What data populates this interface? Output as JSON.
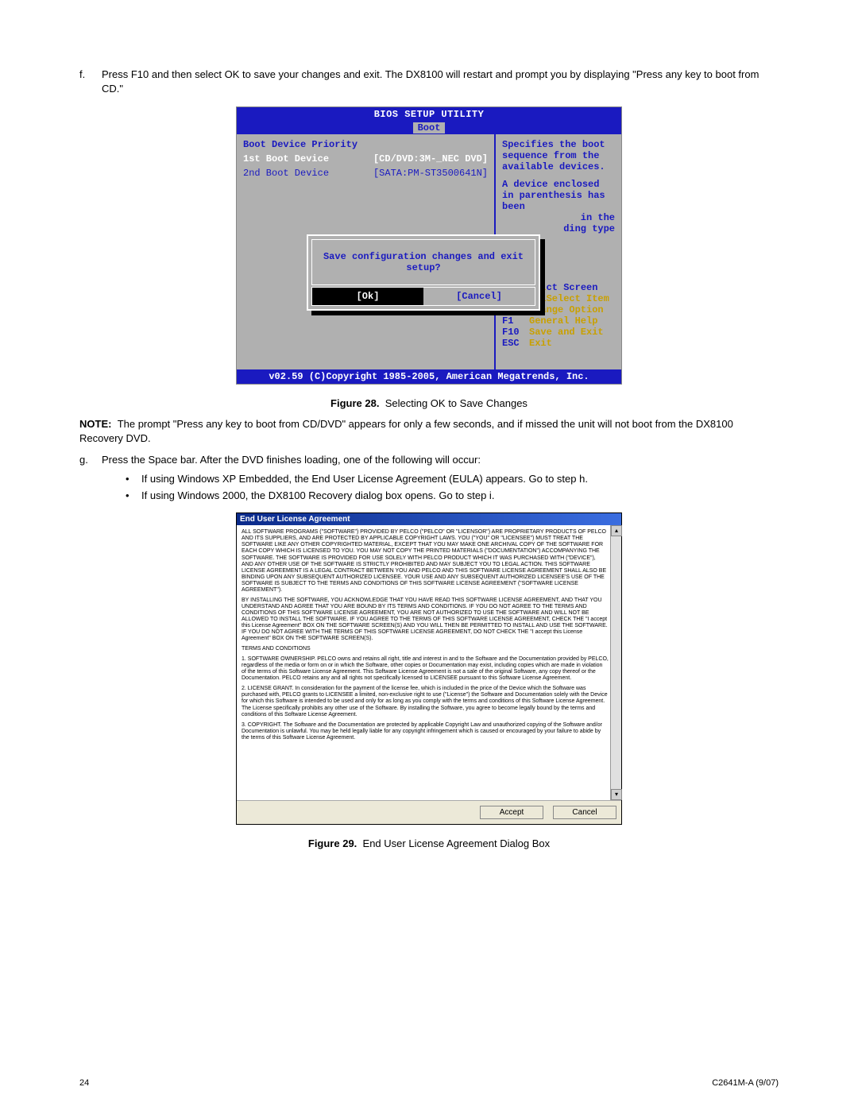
{
  "step_f": {
    "letter": "f.",
    "text": "Press F10 and then select OK to save your changes and exit. The DX8100 will restart and prompt you by displaying \"Press any key to boot from CD.\""
  },
  "bios": {
    "title": "BIOS SETUP UTILITY",
    "tab": "Boot",
    "left_heading": "Boot Device Priority",
    "row1_label": "1st Boot Device",
    "row1_value": "[CD/DVD:3M-_NEC DVD]",
    "row2_label": "2nd Boot Device",
    "row2_value": "[SATA:PM-ST3500641N]",
    "help1": "Specifies the boot sequence from the available devices.",
    "help2": "A device enclosed in parenthesis has been",
    "help3a": "in the",
    "help3b": "ding type",
    "keys_sel_screen": "ct Screen",
    "keys_sel_item": "Select Item",
    "keys_change": "Change Option",
    "keys_help": "General Help",
    "keys_save": "Save and Exit",
    "keys_exit": "Exit",
    "k_arrows1": "↔",
    "k_arrows2": "↑↓",
    "k_pm": "+-",
    "k_f1": "F1",
    "k_f10": "F10",
    "k_esc": "ESC",
    "dialog_msg": "Save configuration changes and exit setup?",
    "dialog_ok": "[Ok]",
    "dialog_cancel": "[Cancel]",
    "footer": "v02.59 (C)Copyright 1985-2005, American Megatrends, Inc."
  },
  "caption28_label": "Figure 28.",
  "caption28_text": "Selecting OK to Save Changes",
  "note_label": "NOTE:",
  "note_text": "The prompt \"Press any key to boot from CD/DVD\" appears for only a few seconds, and if missed the unit will not boot from the DX8100 Recovery DVD.",
  "step_g": {
    "letter": "g.",
    "text": "Press the Space bar. After the DVD finishes loading, one of the following will occur:",
    "b1": "If using Windows XP Embedded, the End User License Agreement (EULA) appears. Go to step h.",
    "b2": "If using Windows 2000, the DX8100 Recovery dialog box opens. Go to step i."
  },
  "eula": {
    "title": "End User License Agreement",
    "p1": "ALL SOFTWARE PROGRAMS (\"SOFTWARE\") PROVIDED BY PELCO (\"PELCO\" OR \"LICENSOR\") ARE PROPRIETARY PRODUCTS OF PELCO AND ITS SUPPLIERS, AND ARE PROTECTED BY APPLICABLE COPYRIGHT LAWS. YOU (\"YOU\" OR \"LICENSEE\") MUST TREAT THE SOFTWARE LIKE ANY OTHER COPYRIGHTED MATERIAL, EXCEPT THAT YOU MAY MAKE ONE ARCHIVAL COPY OF THE SOFTWARE FOR EACH COPY WHICH IS LICENSED TO YOU. YOU MAY NOT COPY THE PRINTED MATERIALS (\"DOCUMENTATION\") ACCOMPANYING THE SOFTWARE. THE SOFTWARE IS PROVIDED FOR USE SOLELY WITH PELCO PRODUCT WHICH IT WAS PURCHASED WITH (\"DEVICE\"), AND ANY OTHER USE OF THE SOFTWARE IS STRICTLY PROHIBITED AND MAY SUBJECT YOU TO LEGAL ACTION. THIS SOFTWARE LICENSE AGREEMENT IS A LEGAL CONTRACT BETWEEN YOU AND PELCO AND THIS SOFTWARE LICENSE AGREEMENT SHALL ALSO BE BINDING UPON ANY SUBSEQUENT AUTHORIZED LICENSEE. YOUR USE AND ANY SUBSEQUENT AUTHORIZED LICENSEE'S USE OF THE SOFTWARE IS SUBJECT TO THE TERMS AND CONDITIONS OF THIS SOFTWARE LICENSE AGREEMENT (\"SOFTWARE LICENSE AGREEMENT\").",
    "p2": "BY INSTALLING THE SOFTWARE, YOU ACKNOWLEDGE THAT YOU HAVE READ THIS SOFTWARE LICENSE AGREEMENT, AND THAT YOU UNDERSTAND AND AGREE THAT YOU ARE BOUND BY ITS TERMS AND CONDITIONS. IF YOU DO NOT AGREE TO THE TERMS AND CONDITIONS OF THIS SOFTWARE LICENSE AGREEMENT, YOU ARE NOT AUTHORIZED TO USE THE SOFTWARE AND WILL NOT BE ALLOWED TO INSTALL THE SOFTWARE. IF YOU AGREE TO THE TERMS OF THIS SOFTWARE LICENSE AGREEMENT, CHECK THE \"I accept this License Agreement\" BOX ON THE SOFTWARE SCREEN(S) AND YOU WILL THEN BE PERMITTED TO INSTALL AND USE THE SOFTWARE. IF YOU DO NOT AGREE WITH THE TERMS OF THIS SOFTWARE LICENSE AGREEMENT, DO NOT CHECK THE \"I accept this License Agreement\" BOX ON THE SOFTWARE SCREEN(S).",
    "p3": "TERMS AND CONDITIONS",
    "p4": "1.        SOFTWARE OWNERSHIP. PELCO owns and retains all right, title and interest in and to the Software and the Documentation provided by PELCO, regardless of the media or form on or in which the Software, other copies or Documentation may exist, including copies which are made in violation of the terms of this Software License Agreement. This Software License Agreement is not a sale of the original Software, any copy thereof or the Documentation. PELCO retains any and all rights not specifically licensed to LICENSEE pursuant to this Software License Agreement.",
    "p5": "2.        LICENSE GRANT. In consideration for the payment of the license fee, which is included in the price of the Device which the Software was purchased with, PELCO grants to LICENSEE a limited, non-exclusive right to use (\"License\") the Software and Documentation solely with the Device for which this Software is intended to be used and only for as long as you comply with the terms and conditions of this Software License Agreement. The License specifically prohibits any other use of the Software. By installing the Software, you agree to become legally bound by the terms and conditions of this Software License Agreement.",
    "p6": "3.        COPYRIGHT. The Software and the Documentation are protected by applicable Copyright Law and unauthorized copying of the Software and/or Documentation is unlawful. You may be held legally liable for any copyright infringement which is caused or encouraged by your failure to abide by the terms of this Software License Agreement.",
    "accept": "Accept",
    "cancel": "Cancel"
  },
  "caption29_label": "Figure 29.",
  "caption29_text": "End User License Agreement Dialog Box",
  "footer_left": "24",
  "footer_right": "C2641M-A (9/07)"
}
